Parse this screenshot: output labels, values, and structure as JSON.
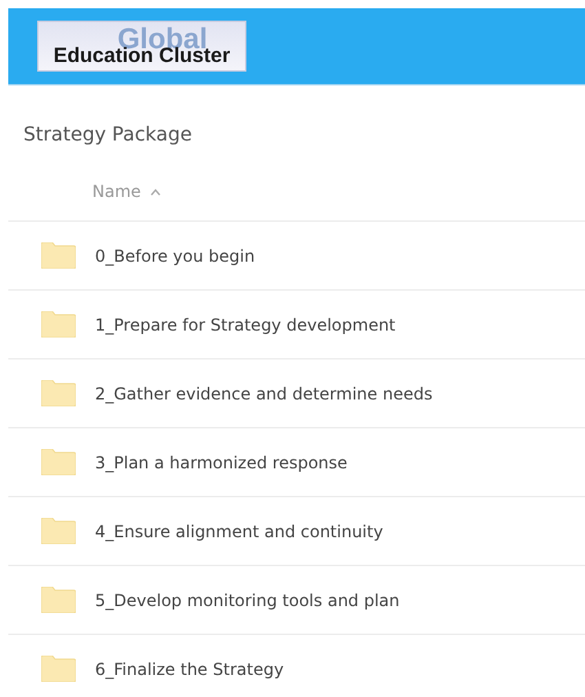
{
  "header": {
    "logo": {
      "top": "Global",
      "bottom": "Education Cluster"
    }
  },
  "title": "Strategy Package",
  "table": {
    "columns": [
      {
        "label": "Name",
        "sort_ascending": true
      }
    ],
    "rows": [
      {
        "name": "0_Before you begin",
        "kind": "folder"
      },
      {
        "name": "1_Prepare for Strategy development",
        "kind": "folder"
      },
      {
        "name": "2_Gather evidence and determine needs",
        "kind": "folder"
      },
      {
        "name": "3_Plan a harmonized response",
        "kind": "folder"
      },
      {
        "name": "4_Ensure alignment and continuity",
        "kind": "folder"
      },
      {
        "name": "5_Develop monitoring tools and plan",
        "kind": "folder"
      },
      {
        "name": "6_Finalize the Strategy",
        "kind": "folder"
      }
    ]
  }
}
